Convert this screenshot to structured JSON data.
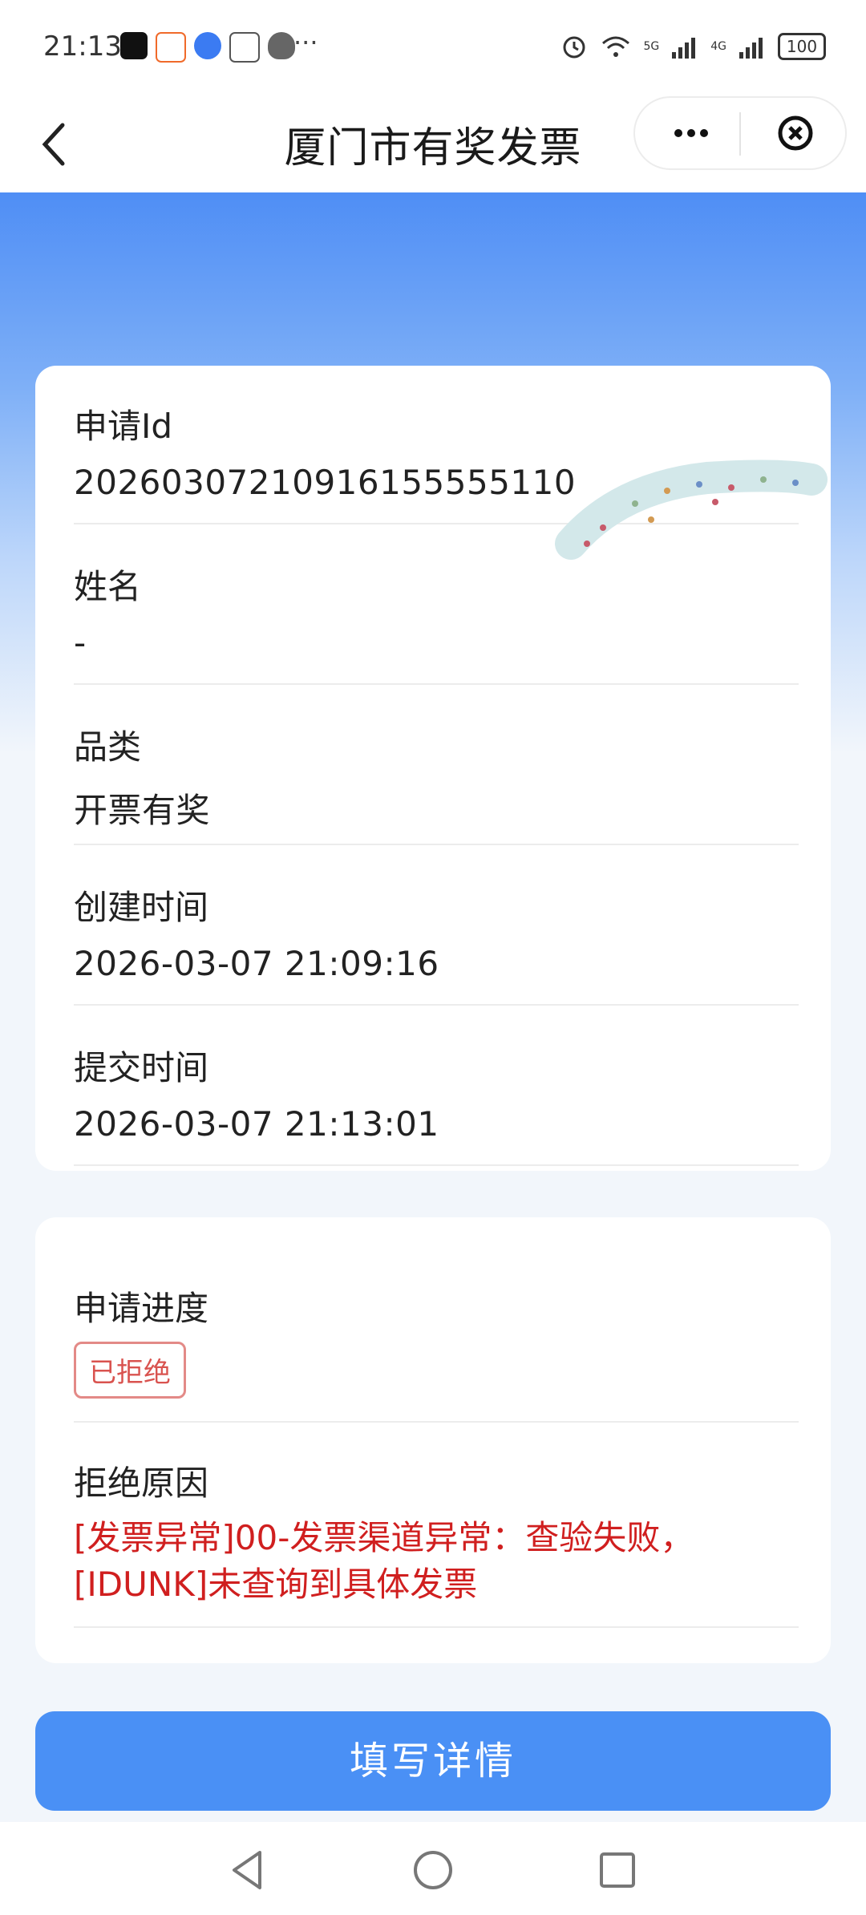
{
  "status_bar": {
    "time": "21:13",
    "battery": "100",
    "network1": "5G",
    "network2": "4G"
  },
  "nav": {
    "title": "厦门市有奖发票"
  },
  "details": {
    "request_id_label": "申请Id",
    "request_id_value": "20260307210916155555110",
    "name_label": "姓名",
    "name_value": "-",
    "category_label": "品类",
    "category_value": "开票有奖",
    "created_label": "创建时间",
    "created_value": "2026-03-07 21:09:16",
    "submitted_label": "提交时间",
    "submitted_value": "2026-03-07 21:13:01"
  },
  "progress": {
    "label": "申请进度",
    "status": "已拒绝",
    "reason_label": "拒绝原因",
    "reason_text": "[发票异常]00-发票渠道异常：查验失败，[IDUNK]未查询到具体发票"
  },
  "actions": {
    "fill_details_label": "填写详情"
  },
  "colors": {
    "brand_blue": "#4a90f5",
    "reject_red": "#d01f1f"
  }
}
